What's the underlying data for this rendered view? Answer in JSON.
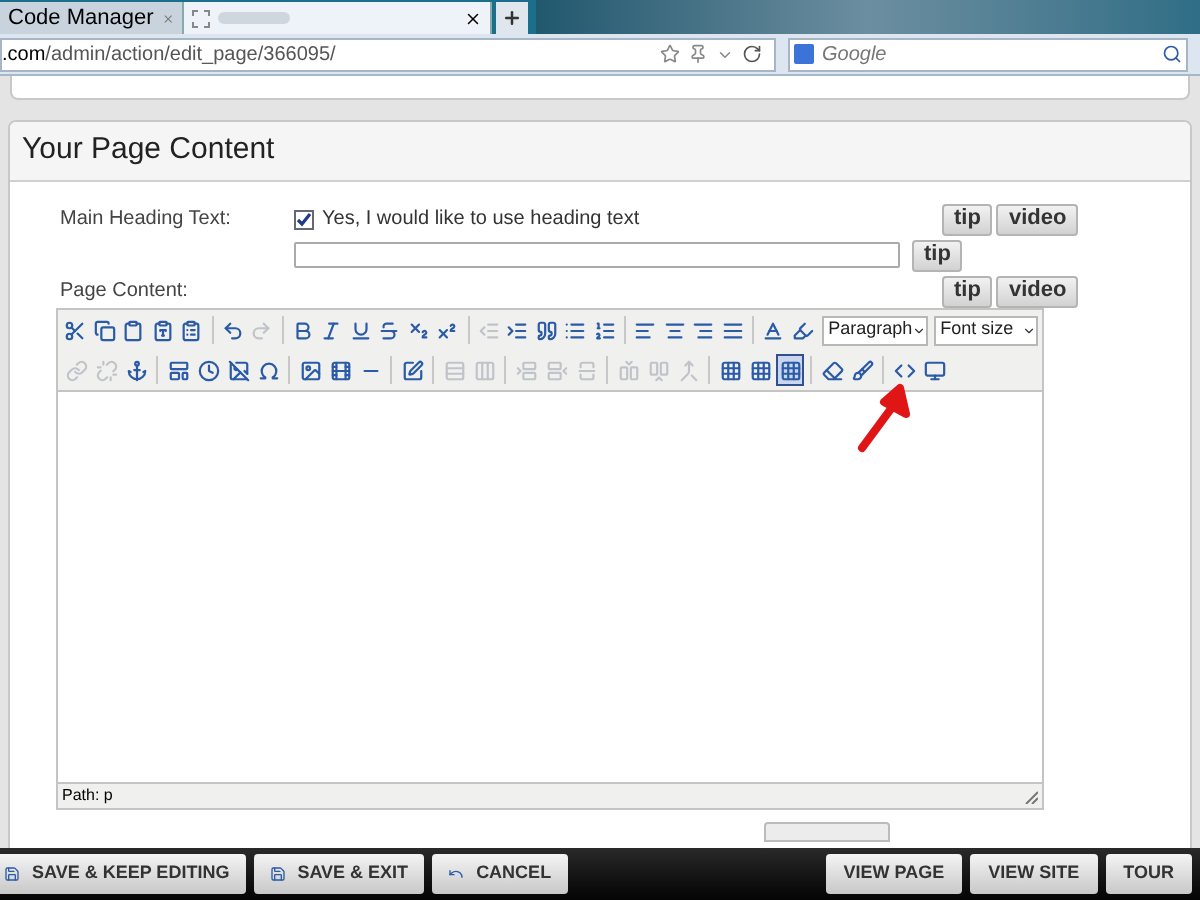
{
  "browser": {
    "tabs": [
      {
        "title": "Code Manager",
        "selected": false
      },
      {
        "selected": true
      }
    ],
    "address": {
      "host": ".com",
      "path": "/admin/action/edit_page/366095/"
    },
    "search": {
      "placeholder": "Google"
    }
  },
  "section": {
    "title": "Your Page Content",
    "heading_field": {
      "label": "Main Heading Text:",
      "checkbox_label": "Yes, I would like to use heading text",
      "checked": true,
      "buttons": [
        "tip",
        "video"
      ],
      "input_buttons": [
        "tip"
      ]
    },
    "content_field": {
      "label": "Page Content:",
      "buttons": [
        "tip",
        "video"
      ]
    },
    "editor": {
      "toolbar_rows": [
        [
          {
            "kind": "cut",
            "disabled": false
          },
          {
            "kind": "copy",
            "disabled": false
          },
          {
            "kind": "paste",
            "disabled": false
          },
          {
            "kind": "paste-text",
            "disabled": false
          },
          {
            "kind": "paste-word",
            "disabled": false
          },
          {
            "kind": "sep"
          },
          {
            "kind": "undo",
            "disabled": false
          },
          {
            "kind": "redo",
            "disabled": true
          },
          {
            "kind": "sep"
          },
          {
            "kind": "bold",
            "disabled": false
          },
          {
            "kind": "italic",
            "disabled": false
          },
          {
            "kind": "underline",
            "disabled": false
          },
          {
            "kind": "strike",
            "disabled": false
          },
          {
            "kind": "sub",
            "disabled": false
          },
          {
            "kind": "sup",
            "disabled": false
          },
          {
            "kind": "sep"
          },
          {
            "kind": "outdent",
            "disabled": true
          },
          {
            "kind": "indent",
            "disabled": false
          },
          {
            "kind": "quote",
            "disabled": false
          },
          {
            "kind": "bullets",
            "disabled": false
          },
          {
            "kind": "numbers",
            "disabled": false
          },
          {
            "kind": "sep"
          },
          {
            "kind": "align-left",
            "disabled": false
          },
          {
            "kind": "align-center",
            "disabled": false
          },
          {
            "kind": "align-right",
            "disabled": false
          },
          {
            "kind": "justify",
            "disabled": false
          },
          {
            "kind": "sep"
          },
          {
            "kind": "font-color",
            "disabled": false
          },
          {
            "kind": "highlight",
            "disabled": false
          }
        ],
        [
          {
            "kind": "link",
            "disabled": true
          },
          {
            "kind": "unlink",
            "disabled": true
          },
          {
            "kind": "anchor",
            "disabled": false
          },
          {
            "kind": "sep"
          },
          {
            "kind": "template",
            "disabled": false
          },
          {
            "kind": "time",
            "disabled": false
          },
          {
            "kind": "no-image",
            "disabled": false
          },
          {
            "kind": "omega",
            "disabled": false
          },
          {
            "kind": "sep"
          },
          {
            "kind": "image",
            "disabled": false
          },
          {
            "kind": "media",
            "disabled": false
          },
          {
            "kind": "rule",
            "disabled": false
          },
          {
            "kind": "sep"
          },
          {
            "kind": "edit",
            "disabled": false
          },
          {
            "kind": "sep"
          },
          {
            "kind": "rows",
            "disabled": true
          },
          {
            "kind": "cols",
            "disabled": true
          },
          {
            "kind": "sep"
          },
          {
            "kind": "row-add",
            "disabled": true
          },
          {
            "kind": "row-del",
            "disabled": true
          },
          {
            "kind": "split",
            "disabled": true
          },
          {
            "kind": "sep"
          },
          {
            "kind": "col-add",
            "disabled": true
          },
          {
            "kind": "col-del",
            "disabled": true
          },
          {
            "kind": "merge",
            "disabled": true
          },
          {
            "kind": "sep"
          },
          {
            "kind": "grid",
            "disabled": false,
            "selected": false
          },
          {
            "kind": "grid",
            "disabled": false,
            "selected": false
          },
          {
            "kind": "grid",
            "disabled": false,
            "selected": true
          },
          {
            "kind": "sep"
          },
          {
            "kind": "eraser",
            "disabled": false
          },
          {
            "kind": "cleanup",
            "disabled": false
          },
          {
            "kind": "sep"
          },
          {
            "kind": "html",
            "disabled": false
          },
          {
            "kind": "preview",
            "disabled": false
          }
        ]
      ],
      "format_select": "Paragraph",
      "size_select": "Font size",
      "path": "Path: p"
    }
  },
  "action_bar": {
    "left": [
      {
        "label": "SAVE & KEEP EDITING",
        "kind": "save"
      },
      {
        "label": "SAVE & EXIT",
        "kind": "save"
      },
      {
        "label": "CANCEL",
        "kind": "undo"
      }
    ],
    "right": [
      {
        "label": "VIEW PAGE"
      },
      {
        "label": "VIEW SITE"
      },
      {
        "label": "TOUR"
      }
    ]
  }
}
